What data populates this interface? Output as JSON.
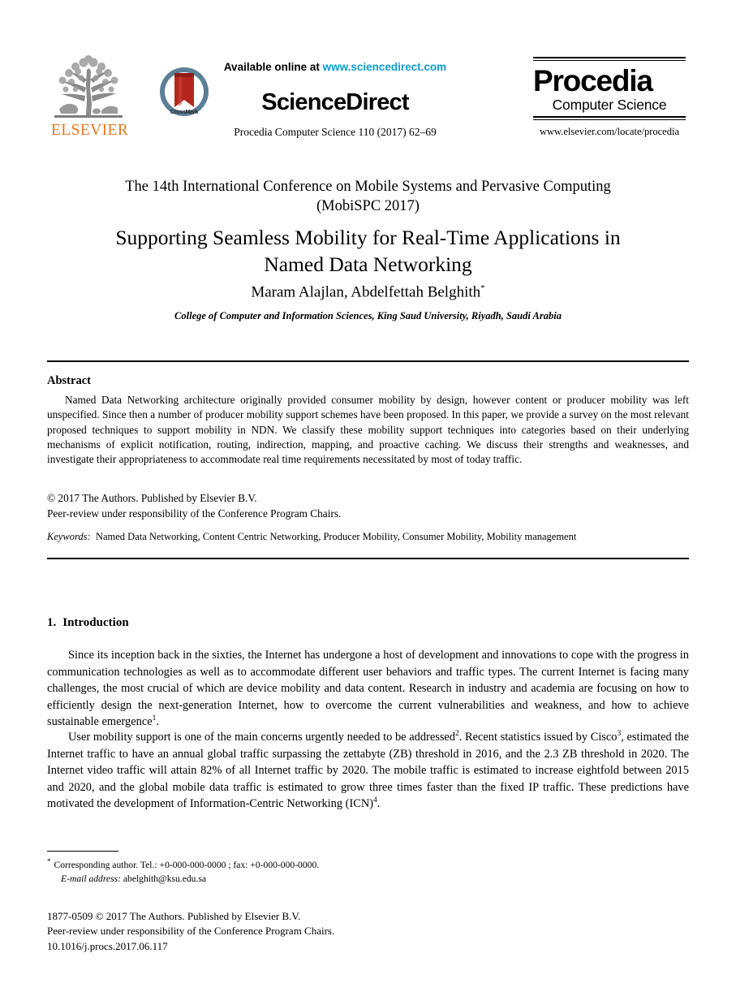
{
  "masthead": {
    "elsevier_wordmark": "ELSEVIER",
    "crossmark_label": "CrossMark",
    "available_prefix": "Available online at ",
    "available_link": "www.sciencedirect.com",
    "brand": "ScienceDirect",
    "journal_reference": "Procedia Computer Science 110 (2017) 62–69",
    "procedia_title": "Procedia",
    "procedia_subtitle": "Computer Science",
    "procedia_url": "www.elsevier.com/locate/procedia",
    "colors": {
      "elsevier_orange": "#E87722",
      "link_blue": "#0C9BD4",
      "crossmark_red": "#B5271E",
      "crossmark_ring": "#5B7F96"
    }
  },
  "title_block": {
    "conference_line_1": "The 14th International Conference on Mobile Systems and Pervasive Computing",
    "conference_line_2": "(MobiSPC 2017)",
    "title_line_1": "Supporting Seamless Mobility for Real-Time Applications in",
    "title_line_2": "Named Data Networking",
    "authors": "Maram Alajlan, Abdelfettah Belghith",
    "author_marker": "*",
    "affiliation": "College of Computer and Information Sciences, King Saud University, Riyadh, Saudi Arabia"
  },
  "abstract": {
    "heading": "Abstract",
    "text": "Named Data Networking architecture originally provided consumer mobility by design, however content or producer mobility was left unspecified. Since then a number of producer mobility support schemes have been proposed. In this paper, we provide a survey on the most relevant proposed techniques to support mobility in NDN. We classify these mobility support techniques into categories based on their underlying mechanisms of explicit notification, routing, indirection, mapping, and proactive caching. We discuss their strengths and weaknesses, and investigate their appropriateness to accommodate real time requirements necessitated by most of today traffic.",
    "copyright_line_1": "© 2017 The Authors. Published by Elsevier B.V.",
    "copyright_line_2": "Peer-review under responsibility of the Conference Program Chairs.",
    "keywords_label": "Keywords:",
    "keywords_value": "Named Data Networking, Content Centric Networking, Producer Mobility, Consumer Mobility, Mobility management"
  },
  "body": {
    "section_number": "1.",
    "section_title": "Introduction",
    "paragraph_1_a": "Since its inception back in the sixties, the Internet has undergone a host of development and innovations to cope with the progress in communication technologies as well as to accommodate different user behaviors and traffic types. The current Internet is facing many challenges, the most crucial of which are device mobility and data content. Research in industry and academia are focusing on how to efficiently design the next-generation Internet, how to overcome the current vulnerabilities and weakness, and how to achieve sustainable emergence",
    "paragraph_1_ref": "1",
    "paragraph_1_b": ".",
    "paragraph_2_a": "User mobility support is one of the main concerns urgently needed to be addressed",
    "paragraph_2_ref_1": "2",
    "paragraph_2_b": ". Recent statistics issued by Cisco",
    "paragraph_2_ref_2": "3",
    "paragraph_2_c": ", estimated the Internet traffic to have an annual global traffic surpassing the zettabyte (ZB) threshold in 2016, and the 2.3 ZB threshold in 2020. The Internet video traffic will attain 82% of all Internet traffic by 2020. The mobile traffic is estimated to increase eightfold between 2015 and 2020, and the global mobile data traffic is estimated to grow three times faster than the fixed IP traffic. These predictions have motivated the development of Information-Centric Networking (ICN)",
    "paragraph_2_ref_3": "4",
    "paragraph_2_d": "."
  },
  "footnote": {
    "marker": "*",
    "line_1": "Corresponding author. Tel.: +0-000-000-0000 ; fax: +0-000-000-0000.",
    "email_label": "E-mail address:",
    "email_value": "abelghith@ksu.edu.sa"
  },
  "publisher_footer": {
    "line_1": "1877-0509 © 2017 The Authors. Published by Elsevier B.V.",
    "line_2": "Peer-review under responsibility of the Conference Program Chairs.",
    "line_3": "10.1016/j.procs.2017.06.117"
  }
}
